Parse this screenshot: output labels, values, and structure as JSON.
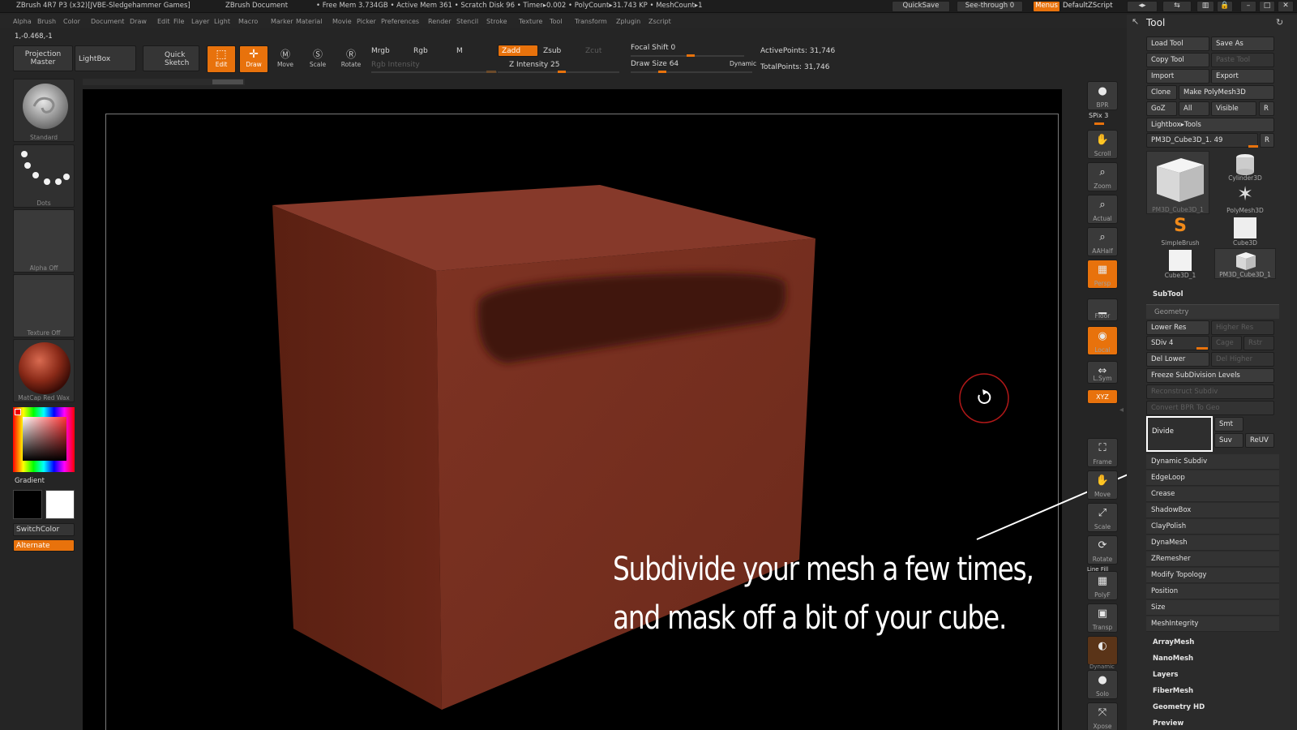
{
  "titlebar": {
    "app": "ZBrush 4R7 P3 (x32)[JVBE-Sledgehammer Games]",
    "doc": "ZBrush Document",
    "mem": "• Free Mem 3.734GB • Active Mem 361 • Scratch Disk 96 • Timer▸0.002 • PolyCount▸31.743 KP • MeshCount▸1",
    "quicksave": "QuickSave",
    "see_through": "See-through 0",
    "menus": "Menus",
    "default_script": "DefaultZScript"
  },
  "menubar": [
    "Alpha",
    "Brush",
    "Color",
    "Document",
    "Draw",
    "Edit",
    "File",
    "Layer",
    "Light",
    "Macro",
    "Marker",
    "Material",
    "Movie",
    "Picker",
    "Preferences",
    "Render",
    "Stencil",
    "Stroke",
    "Texture",
    "Tool",
    "Transform",
    "Zplugin",
    "Zscript"
  ],
  "coords": "1,-0.468,-1",
  "toolbar": {
    "projection_master": "Projection Master",
    "lightbox": "LightBox",
    "quick_sketch": "Quick Sketch",
    "edit": "Edit",
    "draw": "Draw",
    "move": "Move",
    "scale": "Scale",
    "rotate": "Rotate",
    "mrgb": "Mrgb",
    "rgb": "Rgb",
    "m": "M",
    "rgb_intensity": "Rgb Intensity",
    "zadd": "Zadd",
    "zsub": "Zsub",
    "zcut": "Zcut",
    "z_intensity": "Z Intensity 25",
    "z_intensity_level": 0.25,
    "focal_shift": "Focal Shift 0",
    "draw_size": "Draw Size 64",
    "dynamic": "Dynamic",
    "active_points": "ActivePoints: 31,746",
    "total_points": "TotalPoints: 31,746"
  },
  "left_shelf": {
    "brush": "Standard",
    "stroke": "Dots",
    "alpha": "Alpha Off",
    "texture": "Texture Off",
    "material": "MatCap Red Wax",
    "gradient": "Gradient",
    "switchcolor": "SwitchColor",
    "alternate": "Alternate"
  },
  "right_shelf": [
    {
      "name": "BPR",
      "label": "BPR",
      "glyph": "●"
    },
    {
      "name": "Scroll",
      "label": "Scroll",
      "glyph": "✋"
    },
    {
      "name": "Zoom",
      "label": "Zoom",
      "glyph": "⌕"
    },
    {
      "name": "Actual",
      "label": "Actual",
      "glyph": "⌕"
    },
    {
      "name": "AAHalf",
      "label": "AAHalf",
      "glyph": "⌕"
    },
    {
      "name": "Persp",
      "label": "Persp",
      "glyph": "▦"
    },
    {
      "name": "Floor",
      "label": "Floor",
      "glyph": "▁"
    },
    {
      "name": "Local",
      "label": "Local",
      "glyph": "◉"
    },
    {
      "name": "LSym",
      "label": "L.Sym",
      "glyph": "⇔"
    },
    {
      "name": "XYZ",
      "label": "XYZ",
      "glyph": "✕"
    },
    {
      "name": "Frame",
      "label": "Frame",
      "glyph": "⛶"
    },
    {
      "name": "Move",
      "label": "Move",
      "glyph": "✋"
    },
    {
      "name": "Scale",
      "label": "Scale",
      "glyph": "⤢"
    },
    {
      "name": "Rotate",
      "label": "Rotate",
      "glyph": "⟳"
    },
    {
      "name": "PolyF",
      "label": "PolyF",
      "glyph": "▦"
    },
    {
      "name": "Transp",
      "label": "Transp",
      "glyph": "▣"
    },
    {
      "name": "Ghost",
      "label": "",
      "glyph": "◐"
    },
    {
      "name": "Solo",
      "label": "Solo",
      "glyph": "●"
    },
    {
      "name": "Xpose",
      "label": "Xpose",
      "glyph": "⤧"
    }
  ],
  "spix": "SPix 3",
  "line_fill": "Line Fill",
  "dynamic_label": "Dynamic",
  "tool_panel": {
    "title": "Tool",
    "load_tool": "Load Tool",
    "save_as": "Save As",
    "copy_tool": "Copy Tool",
    "paste_tool": "Paste Tool",
    "import": "Import",
    "export": "Export",
    "clone": "Clone",
    "make_polymesh": "Make PolyMesh3D",
    "goz": "GoZ",
    "all": "All",
    "visible": "Visible",
    "r": "R",
    "lightbox_tools": "Lightbox▸Tools",
    "current_tool": "PM3D_Cube3D_1. 49",
    "thumbs": [
      {
        "label": "PM3D_Cube3D_1"
      },
      {
        "label": "Cylinder3D"
      },
      {
        "label": "PolyMesh3D"
      },
      {
        "label": "SimpleBrush"
      },
      {
        "label": "Cube3D"
      },
      {
        "label": "Cube3D_1"
      },
      {
        "label": "PM3D_Cube3D_1"
      }
    ],
    "subtool": "SubTool",
    "geometry": "Geometry",
    "lower_res": "Lower Res",
    "higher_res": "Higher Res",
    "sdiv": "SDiv 4",
    "cage": "Cage",
    "rstr": "Rstr",
    "del_lower": "Del Lower",
    "del_higher": "Del Higher",
    "freeze": "Freeze SubDivision Levels",
    "reconstruct": "Reconstruct Subdiv",
    "convert_bpr": "Convert BPR To Geo",
    "divide": "Divide",
    "smt": "Smt",
    "suv": "Suv",
    "reuv": "ReUV",
    "rows": [
      "Dynamic Subdiv",
      "EdgeLoop",
      "Crease",
      "ShadowBox",
      "ClayPolish",
      "DynaMesh",
      "ZRemesher",
      "Modify Topology",
      "Position",
      "Size",
      "MeshIntegrity"
    ],
    "sections": [
      "ArrayMesh",
      "NanoMesh",
      "Layers",
      "FiberMesh",
      "Geometry HD",
      "Preview"
    ]
  },
  "annotation": {
    "line1": "Subdivide your mesh a few times,",
    "line2": "and mask off a bit of your cube."
  },
  "colors": {
    "accent": "#e8720c",
    "cube_front": "#7f3424",
    "cube_top": "#8a3a2a",
    "cube_side": "#6a2818",
    "mask": "#3f140c"
  }
}
